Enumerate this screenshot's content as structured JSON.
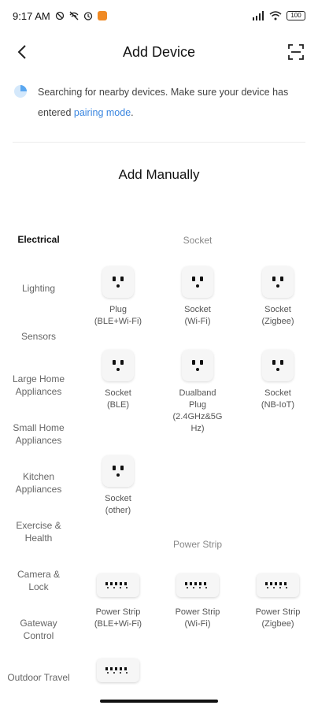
{
  "status_bar": {
    "time": "9:17 AM",
    "battery": "100",
    "icons": [
      "data-saver-icon",
      "wifi-off-icon",
      "alarm-icon",
      "app-badge-icon",
      "signal-icon",
      "wifi-icon",
      "battery-icon"
    ]
  },
  "header": {
    "title": "Add Device",
    "back_icon": "chevron-left-icon",
    "scan_icon": "scan-icon"
  },
  "notice": {
    "text": "Searching for nearby devices. Make sure your device has entered ",
    "link": "pairing mode",
    "suffix": "."
  },
  "section_title": "Add Manually",
  "sidebar": {
    "items": [
      {
        "label": "Electrical",
        "active": true
      },
      {
        "label": "Lighting"
      },
      {
        "label": "Sensors"
      },
      {
        "label": "Large Home Appliances"
      },
      {
        "label": "Small Home Appliances"
      },
      {
        "label": "Kitchen Appliances"
      },
      {
        "label": "Exercise & Health"
      },
      {
        "label": "Camera & Lock"
      },
      {
        "label": "Gateway Control"
      },
      {
        "label": "Outdoor Travel"
      }
    ]
  },
  "groups": {
    "socket": {
      "title": "Socket",
      "devices": [
        {
          "name": "Plug",
          "sub": "(BLE+Wi-Fi)"
        },
        {
          "name": "Socket",
          "sub": "(Wi-Fi)"
        },
        {
          "name": "Socket",
          "sub": "(Zigbee)"
        },
        {
          "name": "Socket",
          "sub": "(BLE)"
        },
        {
          "name": "Dualband Plug",
          "sub": "(2.4GHz&5G Hz)"
        },
        {
          "name": "Socket",
          "sub": "(NB-IoT)"
        },
        {
          "name": "Socket",
          "sub": "(other)"
        }
      ]
    },
    "power_strip": {
      "title": "Power Strip",
      "devices": [
        {
          "name": "Power Strip",
          "sub": "(BLE+Wi-Fi)"
        },
        {
          "name": "Power Strip",
          "sub": "(Wi-Fi)"
        },
        {
          "name": "Power Strip",
          "sub": "(Zigbee)"
        }
      ]
    }
  },
  "colors": {
    "link": "#3a86e0",
    "notice_icon": "#5aa7f0",
    "app_badge": "#f08a24"
  }
}
